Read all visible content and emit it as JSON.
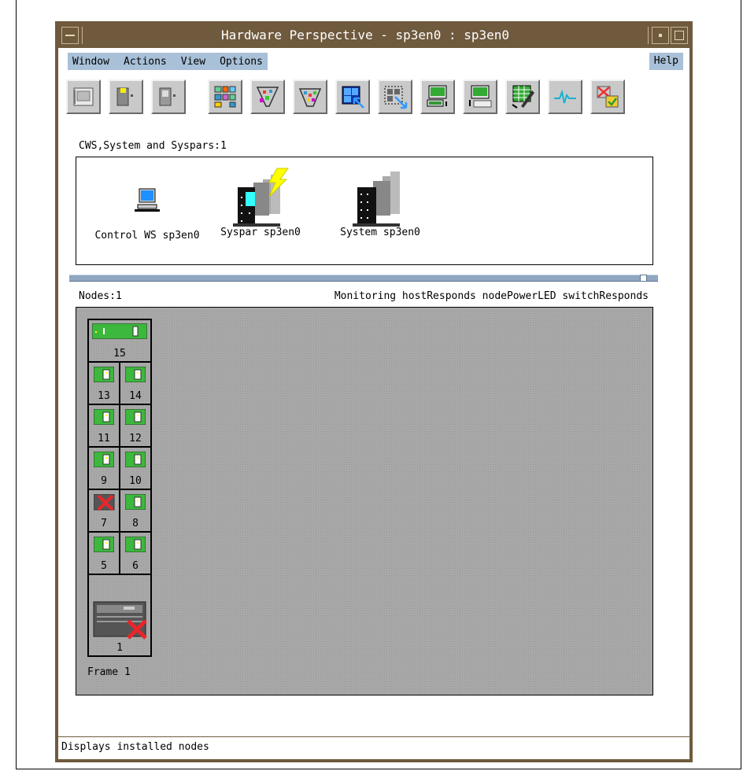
{
  "window": {
    "title": "Hardware Perspective - sp3en0 : sp3en0"
  },
  "menubar": {
    "items": [
      "Window",
      "Actions",
      "View",
      "Options"
    ],
    "help": "Help"
  },
  "toolbar": {
    "buttons": [
      "open-icon",
      "frame-icon",
      "node-icon",
      "layout-icon",
      "filter-icon",
      "filter-set-icon",
      "select-all-icon",
      "deselect-icon",
      "monitor-icon",
      "command-icon",
      "table-edit-icon",
      "graph-icon",
      "delete-icon"
    ]
  },
  "cws": {
    "header": "CWS,System and Syspars:1",
    "items": [
      {
        "icon": "workstation-icon",
        "label": "Control WS sp3en0"
      },
      {
        "icon": "syspar-icon",
        "label": "Syspar sp3en0"
      },
      {
        "icon": "system-icon",
        "label": "System sp3en0"
      }
    ]
  },
  "nodes": {
    "header": "Nodes:1",
    "monitoring": "Monitoring hostResponds nodePowerLED switchResponds",
    "frame_label": "Frame 1",
    "cells": [
      {
        "num": "15",
        "status": "ok"
      },
      {
        "num": "13",
        "status": "ok"
      },
      {
        "num": "14",
        "status": "ok"
      },
      {
        "num": "11",
        "status": "ok"
      },
      {
        "num": "12",
        "status": "ok"
      },
      {
        "num": "9",
        "status": "ok"
      },
      {
        "num": "10",
        "status": "ok"
      },
      {
        "num": "7",
        "status": "error"
      },
      {
        "num": "8",
        "status": "ok"
      },
      {
        "num": "5",
        "status": "ok"
      },
      {
        "num": "6",
        "status": "ok"
      },
      {
        "num": "1",
        "status": "error"
      }
    ]
  },
  "status": {
    "text": "Displays installed nodes"
  },
  "colors": {
    "frame": "#6f5a3e",
    "menu": "#a8c0d8",
    "node_ok": "#3cb83c",
    "error": "#e8262a",
    "pane": "#a8a8a8"
  }
}
